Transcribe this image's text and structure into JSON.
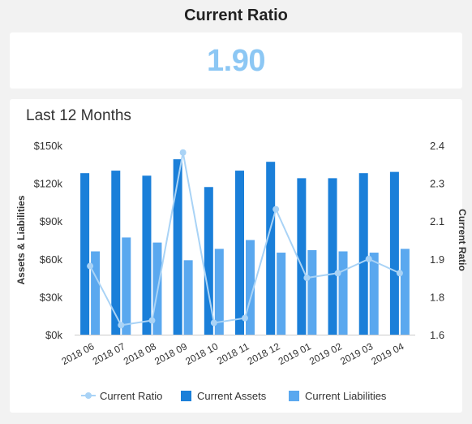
{
  "header": {
    "title": "Current Ratio"
  },
  "kpi": {
    "value": "1.90"
  },
  "chart_card": {
    "title": "Last 12 Months"
  },
  "chart_data": {
    "type": "bar",
    "categories": [
      "2018 06",
      "2018 07",
      "2018 08",
      "2018 09",
      "2018 10",
      "2018 11",
      "2018 12",
      "2019 01",
      "2019 02",
      "2019 03",
      "2019 04"
    ],
    "series": [
      {
        "name": "Current Assets",
        "type": "bar",
        "axis": "left",
        "color": "#1a7fd9",
        "values": [
          128000,
          130000,
          126000,
          139000,
          117000,
          130000,
          137000,
          124000,
          124000,
          128000,
          129000
        ]
      },
      {
        "name": "Current Liabilities",
        "type": "bar",
        "axis": "left",
        "color": "#5aa8ef",
        "values": [
          66000,
          77000,
          73000,
          59000,
          68000,
          75000,
          65000,
          67000,
          66000,
          65000,
          68000
        ]
      },
      {
        "name": "Current Ratio",
        "type": "line",
        "axis": "right",
        "color": "#a9d3f6",
        "values": [
          1.89,
          1.64,
          1.66,
          2.37,
          1.65,
          1.67,
          2.13,
          1.84,
          1.86,
          1.92,
          1.86
        ]
      }
    ],
    "y_left": {
      "label": "Assets & Liabilities",
      "ylim": [
        0,
        150000
      ],
      "ticks": [
        "$0k",
        "$30k",
        "$60k",
        "$90k",
        "$120k",
        "$150k"
      ]
    },
    "y_right": {
      "label": "Current Ratio",
      "ylim": [
        1.6,
        2.4
      ],
      "ticks": [
        "1.6",
        "1.8",
        "1.9",
        "2.1",
        "2.3",
        "2.4"
      ]
    },
    "legend_position": "bottom",
    "grid": false
  }
}
